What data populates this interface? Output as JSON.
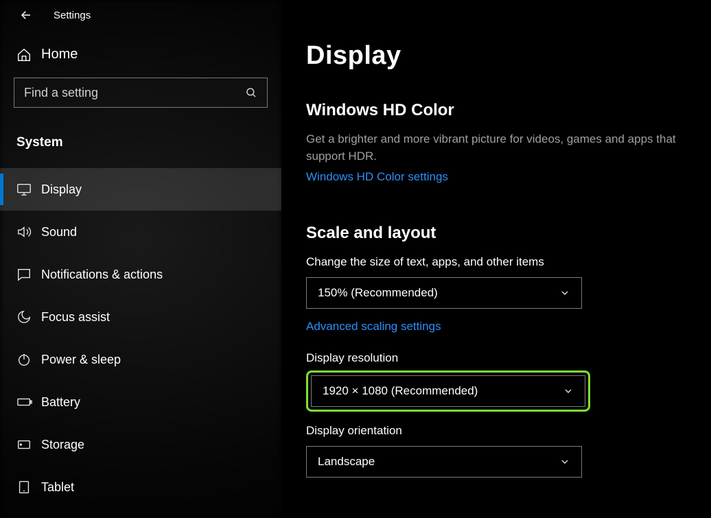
{
  "titlebar": {
    "app_title": "Settings"
  },
  "home_label": "Home",
  "search": {
    "placeholder": "Find a setting"
  },
  "section_header": "System",
  "nav": [
    {
      "label": "Display",
      "icon": "monitor-icon",
      "selected": true
    },
    {
      "label": "Sound",
      "icon": "speaker-icon",
      "selected": false
    },
    {
      "label": "Notifications & actions",
      "icon": "message-icon",
      "selected": false
    },
    {
      "label": "Focus assist",
      "icon": "moon-icon",
      "selected": false
    },
    {
      "label": "Power & sleep",
      "icon": "power-icon",
      "selected": false
    },
    {
      "label": "Battery",
      "icon": "battery-icon",
      "selected": false
    },
    {
      "label": "Storage",
      "icon": "storage-icon",
      "selected": false
    },
    {
      "label": "Tablet",
      "icon": "tablet-icon",
      "selected": false
    }
  ],
  "main": {
    "heading": "Display",
    "hd_color": {
      "title": "Windows HD Color",
      "desc": "Get a brighter and more vibrant picture for videos, games and apps that support HDR.",
      "link": "Windows HD Color settings"
    },
    "scale": {
      "title": "Scale and layout",
      "text_size_label": "Change the size of text, apps, and other items",
      "text_size_value": "150% (Recommended)",
      "advanced_link": "Advanced scaling settings",
      "resolution_label": "Display resolution",
      "resolution_value": "1920 × 1080 (Recommended)",
      "orientation_label": "Display orientation",
      "orientation_value": "Landscape"
    }
  },
  "colors": {
    "accent": "#0078d4",
    "link": "#2e8ef7",
    "highlight": "#7ee233"
  }
}
